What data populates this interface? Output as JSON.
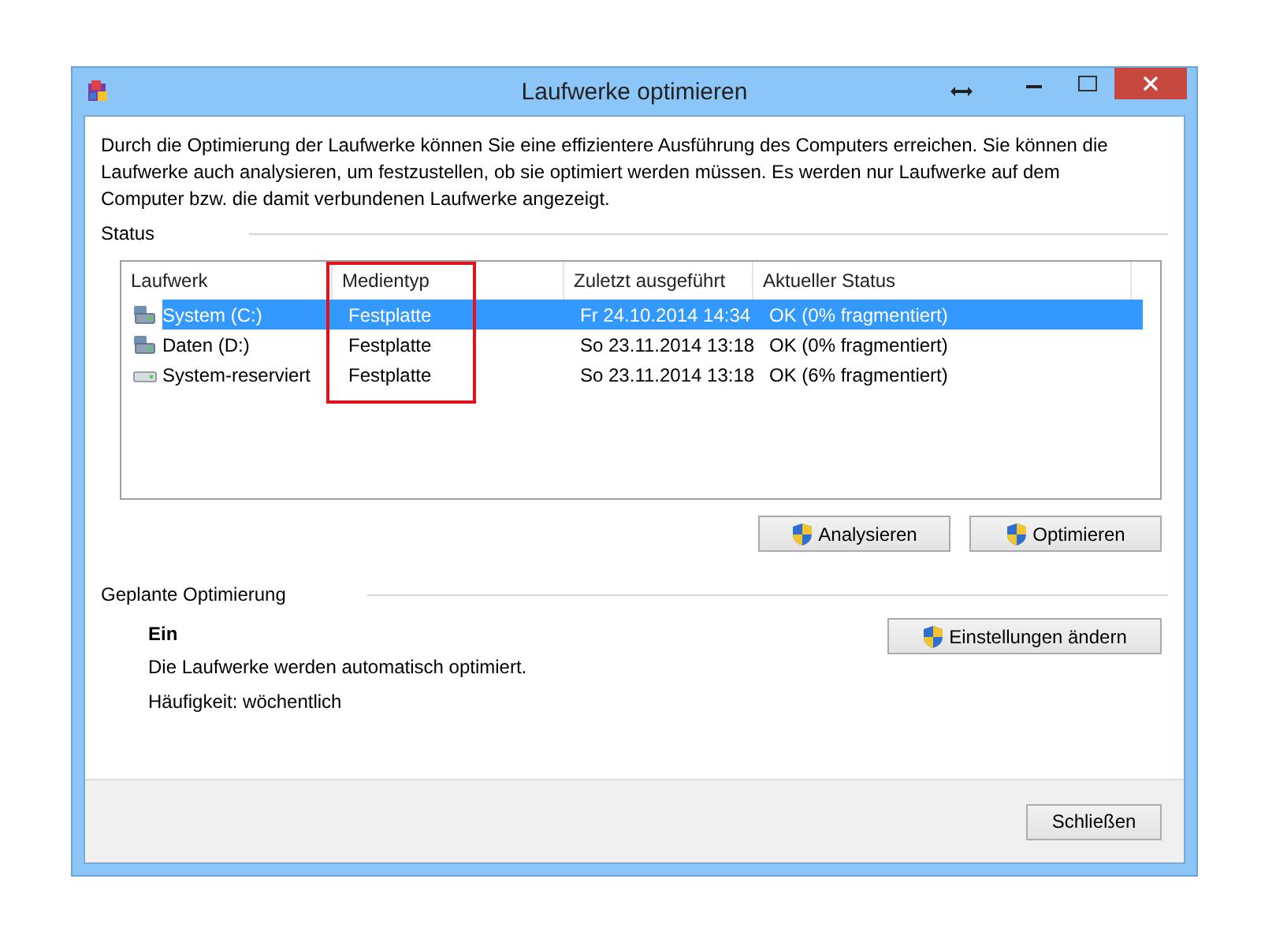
{
  "window": {
    "title": "Laufwerke optimieren"
  },
  "intro": "Durch die Optimierung der Laufwerke können Sie eine effizientere Ausführung des Computers erreichen. Sie können die Laufwerke auch analysieren, um festzustellen, ob sie optimiert werden müssen. Es werden nur Laufwerke auf dem Computer bzw. die damit verbundenen Laufwerke angezeigt.",
  "status": {
    "heading": "Status",
    "table": {
      "columns": [
        "Laufwerk",
        "Medientyp",
        "Zuletzt ausgeführt",
        "Aktueller Status"
      ],
      "rows": [
        {
          "kind": "system",
          "selected": true,
          "cells": [
            "System (C:)",
            "Festplatte",
            "Fr 24.10.2014 14:34",
            "OK (0% fragmentiert)"
          ]
        },
        {
          "kind": "system",
          "selected": false,
          "cells": [
            "Daten (D:)",
            "Festplatte",
            "So 23.11.2014 13:18",
            "OK (0% fragmentiert)"
          ]
        },
        {
          "kind": "plain",
          "selected": false,
          "cells": [
            "System-reserviert",
            "Festplatte",
            "So 23.11.2014 13:18",
            "OK (6% fragmentiert)"
          ]
        }
      ]
    },
    "buttons": [
      "Analysieren",
      "Optimieren"
    ]
  },
  "schedule": {
    "heading": "Geplante Optimierung",
    "state": "Ein",
    "description": "Die Laufwerke werden automatisch optimiert.",
    "frequency": "Häufigkeit: wöchentlich",
    "button": "Einstellungen ändern"
  },
  "footer": {
    "button": "Schließen"
  }
}
